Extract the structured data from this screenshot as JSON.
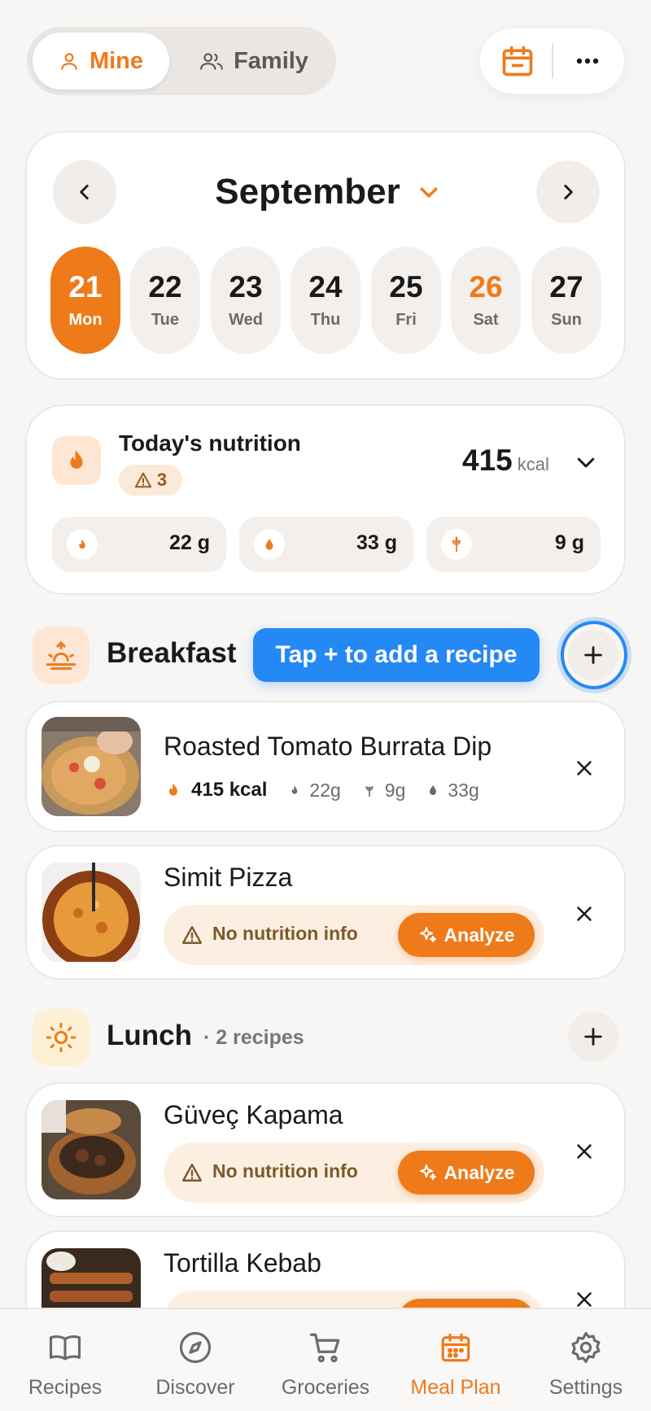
{
  "segment": {
    "mine": "Mine",
    "family": "Family"
  },
  "calendar": {
    "month": "September",
    "days": [
      {
        "num": "21",
        "name": "Mon"
      },
      {
        "num": "22",
        "name": "Tue"
      },
      {
        "num": "23",
        "name": "Wed"
      },
      {
        "num": "24",
        "name": "Thu"
      },
      {
        "num": "25",
        "name": "Fri"
      },
      {
        "num": "26",
        "name": "Sat"
      },
      {
        "num": "27",
        "name": "Sun"
      }
    ]
  },
  "nutrition": {
    "title": "Today's nutrition",
    "warnings": "3",
    "kcal": "415",
    "kcal_unit": "kcal",
    "macros": [
      {
        "icon": "flame-small-icon",
        "value": "22 g"
      },
      {
        "icon": "drop-icon",
        "value": "33 g"
      },
      {
        "icon": "wheat-icon",
        "value": "9 g"
      }
    ]
  },
  "breakfast": {
    "title": "Breakfast",
    "tooltip": "Tap + to add a recipe",
    "recipes": [
      {
        "name": "Roasted Tomato Burrata Dip",
        "kcal": "415 kcal",
        "protein": "22g",
        "carbs": "9g",
        "fat": "33g"
      },
      {
        "name": "Simit Pizza",
        "no_nutrition": "No nutrition info",
        "analyze": "Analyze"
      }
    ]
  },
  "lunch": {
    "title": "Lunch",
    "count": "· 2 recipes",
    "recipes": [
      {
        "name": "Güveç Kapama",
        "no_nutrition": "No nutrition info",
        "analyze": "Analyze"
      },
      {
        "name": "Tortilla Kebab"
      }
    ]
  },
  "tabs": [
    "Recipes",
    "Discover",
    "Groceries",
    "Meal Plan",
    "Settings"
  ],
  "colors": {
    "accent": "#ef7a1a",
    "tooltip": "#2488f5",
    "background": "#f8f6f4"
  }
}
